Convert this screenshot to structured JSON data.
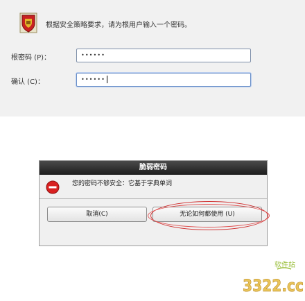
{
  "intro": {
    "text": "根据安全策略要求，请为根用户输入一个密码。"
  },
  "fields": {
    "root_password": {
      "label": "根密码 (P)：",
      "value": "••••••"
    },
    "confirm": {
      "label": "确认 (C)：",
      "value": "••••••"
    }
  },
  "dialog": {
    "title": "脆弱密码",
    "message": "您的密码不够安全：它基于字典单词",
    "cancel_label": "取消(C)",
    "use_anyway_label": "无论如何都使用 (U)"
  },
  "watermark": {
    "site_text": "软件站",
    "brand_text": "3322.cc"
  },
  "colors": {
    "titlebar": "#2b2b2b",
    "warning_red": "#d82020",
    "highlight_red": "#d03030",
    "field_border": "#7d8ea8",
    "panel_bg": "#f1f1f1"
  },
  "icons": {
    "intro": "shield-icon",
    "dialog": "stop-icon"
  }
}
